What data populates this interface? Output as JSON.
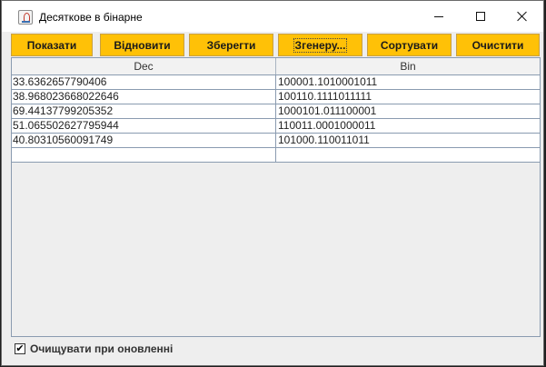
{
  "window": {
    "title": "Десяткове в бінарне"
  },
  "toolbar": {
    "buttons": [
      {
        "label": "Показати"
      },
      {
        "label": "Відновити"
      },
      {
        "label": "Зберегти"
      },
      {
        "label": "Згенеру..."
      },
      {
        "label": "Сортувати"
      },
      {
        "label": "Очистити"
      }
    ],
    "accent_color": "#ffc107"
  },
  "table": {
    "headers": [
      "Dec",
      "Bin"
    ],
    "rows": [
      [
        "33.6362657790406",
        "100001.1010001011"
      ],
      [
        "38.968023668022646",
        "100110.1111011111"
      ],
      [
        "69.44137799205352",
        "1000101.011100001"
      ],
      [
        "51.065502627795944",
        "110011.0001000011"
      ],
      [
        "40.80310560091749",
        "101000.110011011"
      ],
      [
        "",
        ""
      ]
    ]
  },
  "footer": {
    "checkbox_label": "Очищувати при оновленні",
    "checkbox_checked": true,
    "check_mark": "✔"
  }
}
